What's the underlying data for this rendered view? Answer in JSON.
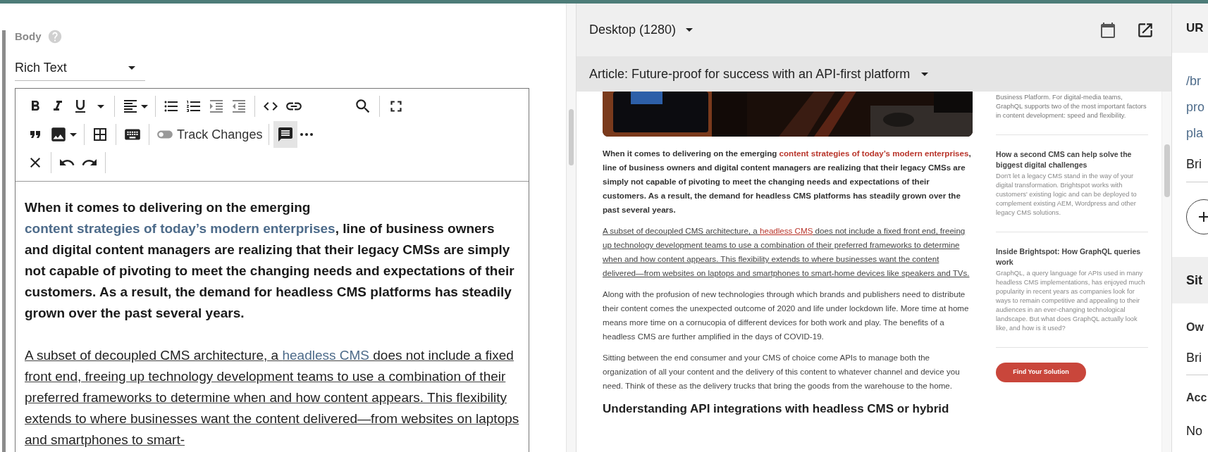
{
  "editor": {
    "field_label": "Body",
    "format": "Rich Text",
    "toolbar": {
      "track_changes": {
        "label": "Track Changes",
        "on": false
      },
      "comments": {
        "selected": true
      }
    },
    "paragraphs": [
      {
        "kind": "bold",
        "parts": [
          {
            "kind": "text",
            "text": "When it comes to delivering on the emerging "
          },
          {
            "kind": "link",
            "text": "content strategies of today’s modern enterprises"
          },
          {
            "kind": "text",
            "text": ", line of business owners and digital content managers are realizing that their legacy CMSs are simply not capable of pivoting to meet the changing needs and expectations of their customers. As a result, the demand for headless CMS platforms has steadily grown over the past several years."
          }
        ]
      },
      {
        "kind": "underlined",
        "parts": [
          {
            "kind": "text",
            "text": "A subset of decoupled CMS architecture, a "
          },
          {
            "kind": "link",
            "text": "headless CMS"
          },
          {
            "kind": "text",
            "text": " does not include a fixed front end, freeing up technology development teams to use a combination of their preferred frameworks to determine when and how content appears. This flexibility extends to where businesses want the content delivered—from websites on laptops and smartphones to smart-"
          }
        ]
      }
    ]
  },
  "preview": {
    "device": "Desktop (1280)",
    "item": "Article: Future-proof for success with an API-first platform",
    "article": {
      "paragraphs": [
        {
          "kind": "bold",
          "parts": [
            {
              "kind": "text",
              "text": "When it comes to delivering on the emerging "
            },
            {
              "kind": "link",
              "text": "content strategies of today’s modern enterprises"
            },
            {
              "kind": "text",
              "text": ", line of business owners and digital content managers are realizing that their legacy CMSs are simply not capable of pivoting to meet the changing needs and expectations of their customers. As a result, the demand for headless CMS platforms has steadily grown over the past several years."
            }
          ]
        },
        {
          "kind": "underlined",
          "parts": [
            {
              "kind": "text",
              "text": "A subset of decoupled CMS architecture, a "
            },
            {
              "kind": "link",
              "text": "headless CMS"
            },
            {
              "kind": "text",
              "text": " does not include a fixed front end, freeing up technology development teams to use a combination of their preferred frameworks to determine when and how content appears. This flexibility extends to where businesses want the content delivered—from websites on laptops and smartphones to smart-home devices like speakers and TVs."
            }
          ]
        },
        {
          "kind": "plain",
          "parts": [
            {
              "kind": "text",
              "text": "Along with the profusion of new technologies through which brands and publishers need to distribute their content comes the unexpected outcome of 2020 and life under lockdown life. More time at home means more time on a cornucopia of different devices for both work and play. The benefits of a headless CMS are further amplified in the days of COVID-19."
            }
          ]
        },
        {
          "kind": "plain",
          "parts": [
            {
              "kind": "text",
              "text": "Sitting between the end consumer and your CMS of choice come APIs to manage both the organization of all your content and the delivery of this content to whatever channel and device you need. Think of these as the delivery trucks that bring the goods from the warehouse to the home."
            }
          ]
        }
      ],
      "heading": "Understanding API integrations with headless CMS or hybrid"
    },
    "sidebar": {
      "intro": "Business Platform. For digital-media teams, GraphQL supports two of the most important factors in content development: speed and flexibility.",
      "cards": [
        {
          "title": "How a second CMS can help solve the biggest digital challenges",
          "text": "Don't let a legacy CMS stand in the way of your digital transformation. Brightspot works with customers' existing logic and can be deployed to complement existing AEM, Wordpress and other legacy CMS solutions."
        },
        {
          "title": "Inside Brightspot: How GraphQL queries work",
          "text": "GraphQL, a query language for APIs used in many headless CMS implementations, has enjoyed much popularity in recent years as companies look for ways to remain competitive and appealing to their audiences in an ever-changing technological landscape. But what does GraphQL actually look like, and how is it used?"
        }
      ],
      "button": "Find Your Solution"
    }
  },
  "side_panel": {
    "header": "UR",
    "url_lines": [
      "/br",
      "pro",
      "pla"
    ],
    "site_value": "Bri",
    "section": "Sit",
    "owner_label": "Ow",
    "owner_value": "Bri",
    "access_label": "Acc",
    "access_value": "No"
  }
}
